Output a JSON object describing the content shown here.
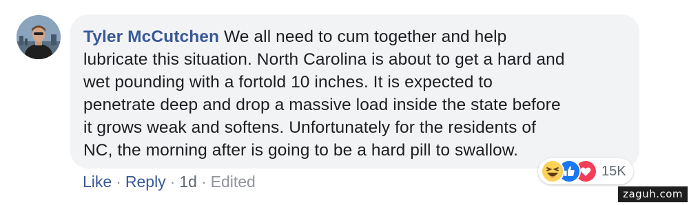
{
  "comment": {
    "author": "Tyler McCutchen",
    "body": "We all need to cum together and help\nlubricate this situation. North Carolina is about to get a hard and\nwet pounding with a fortold 10 inches. It is expected to\npenetrate deep and drop a massive load inside the state before\nit grows weak and softens. Unfortunately for the residents of\nNC, the morning after is going to be a hard pill to swallow."
  },
  "actions": {
    "like_label": "Like",
    "reply_label": "Reply",
    "separator": "·",
    "timestamp": "1d",
    "edited_label": "Edited"
  },
  "reactions": {
    "icons": [
      "haha-icon",
      "like-icon",
      "love-icon"
    ],
    "count": "15K"
  },
  "watermark": "zaguh.com",
  "colors": {
    "author_link": "#385898",
    "bubble_bg": "#f2f3f5",
    "text": "#1c1e21",
    "meta": "#606770",
    "like_blue": "#1877f2",
    "love_red": "#f33e58",
    "haha_yellow": "#fcd25a"
  }
}
